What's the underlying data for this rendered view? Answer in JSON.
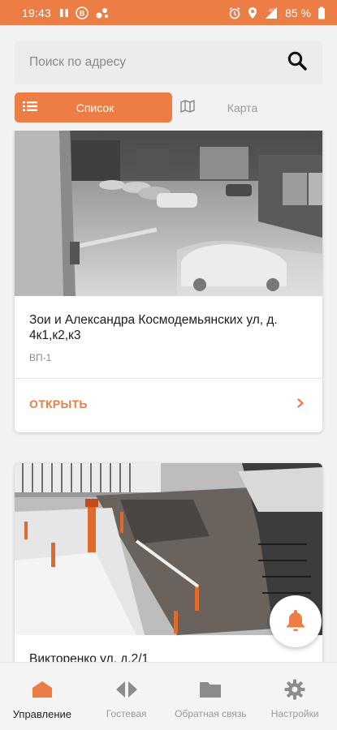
{
  "status_bar": {
    "time": "19:43",
    "battery": "85 %",
    "network": "4G"
  },
  "search": {
    "placeholder": "Поиск по адресу"
  },
  "view_toggle": {
    "list_label": "Список",
    "map_label": "Карта"
  },
  "cards": [
    {
      "address": "Зои и Александра Космодемьянских ул, д. 4к1,к2,к3",
      "device": "ВП-1",
      "action": "ОТКРЫТЬ"
    },
    {
      "address": "Викторенко ул, д.2/1"
    }
  ],
  "bottom_nav": {
    "items": [
      {
        "label": "Управление",
        "icon": "home-icon",
        "active": true
      },
      {
        "label": "Гостевая",
        "icon": "guest-arrows-icon",
        "active": false
      },
      {
        "label": "Обратная связь",
        "icon": "folder-icon",
        "active": false
      },
      {
        "label": "Настройки",
        "icon": "gear-icon",
        "active": false
      }
    ]
  },
  "colors": {
    "accent": "#ec7d45",
    "inactive": "#9a9a9a"
  }
}
